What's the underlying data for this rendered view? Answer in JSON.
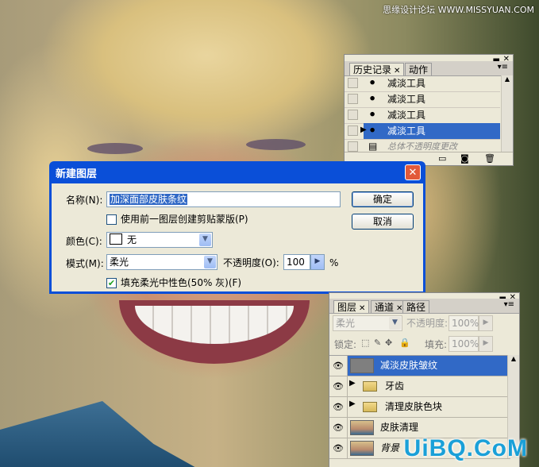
{
  "watermarks": {
    "top": "思缘设计论坛 WWW.MISSYUAN.COM",
    "bottom": "UiBQ.CoM"
  },
  "history_panel": {
    "tabs": [
      {
        "label": "历史记录",
        "active": true
      },
      {
        "label": "动作",
        "active": false
      }
    ],
    "items": [
      {
        "label": "减淡工具",
        "icon": "dodge-tool-icon",
        "selected": false
      },
      {
        "label": "减淡工具",
        "icon": "dodge-tool-icon",
        "selected": false
      },
      {
        "label": "减淡工具",
        "icon": "dodge-tool-icon",
        "selected": false
      },
      {
        "label": "减淡工具",
        "icon": "dodge-tool-icon",
        "selected": true
      },
      {
        "label": "总体不透明度更改",
        "icon": "document-icon",
        "selected": false,
        "dimmed": true
      }
    ]
  },
  "dialog": {
    "title": "新建图层",
    "name_label": "名称(N):",
    "name_value": "加深面部皮肤条纹",
    "clip_checkbox_label": "使用前一图层创建剪贴蒙版(P)",
    "clip_checked": false,
    "color_label": "颜色(C):",
    "color_value": "无",
    "mode_label": "模式(M):",
    "mode_value": "柔光",
    "opacity_label": "不透明度(O):",
    "opacity_value": "100",
    "opacity_unit": "%",
    "fill_checkbox_label": "填充柔光中性色(50% 灰)(F)",
    "fill_checked": true,
    "ok_label": "确定",
    "cancel_label": "取消"
  },
  "layers_panel": {
    "tabs": [
      {
        "label": "图层",
        "active": true
      },
      {
        "label": "通道",
        "active": false
      },
      {
        "label": "路径",
        "active": false
      }
    ],
    "blend_mode": "柔光",
    "opacity_label": "不透明度:",
    "opacity_value": "100%",
    "lock_label": "锁定:",
    "fill_label": "填充:",
    "fill_value": "100%",
    "layers": [
      {
        "name": "减淡皮肤皱纹",
        "type": "layer",
        "active": true
      },
      {
        "name": "牙齿",
        "type": "group",
        "active": false
      },
      {
        "name": "清理皮肤色块",
        "type": "group",
        "active": false
      },
      {
        "name": "皮肤清理",
        "type": "layer",
        "active": false
      },
      {
        "name": "背景",
        "type": "background",
        "active": false
      }
    ]
  },
  "colors": {
    "dialog_title_bar": "#0a4fd8",
    "selection": "#3169c6",
    "panel_bg": "#ece9d8"
  }
}
